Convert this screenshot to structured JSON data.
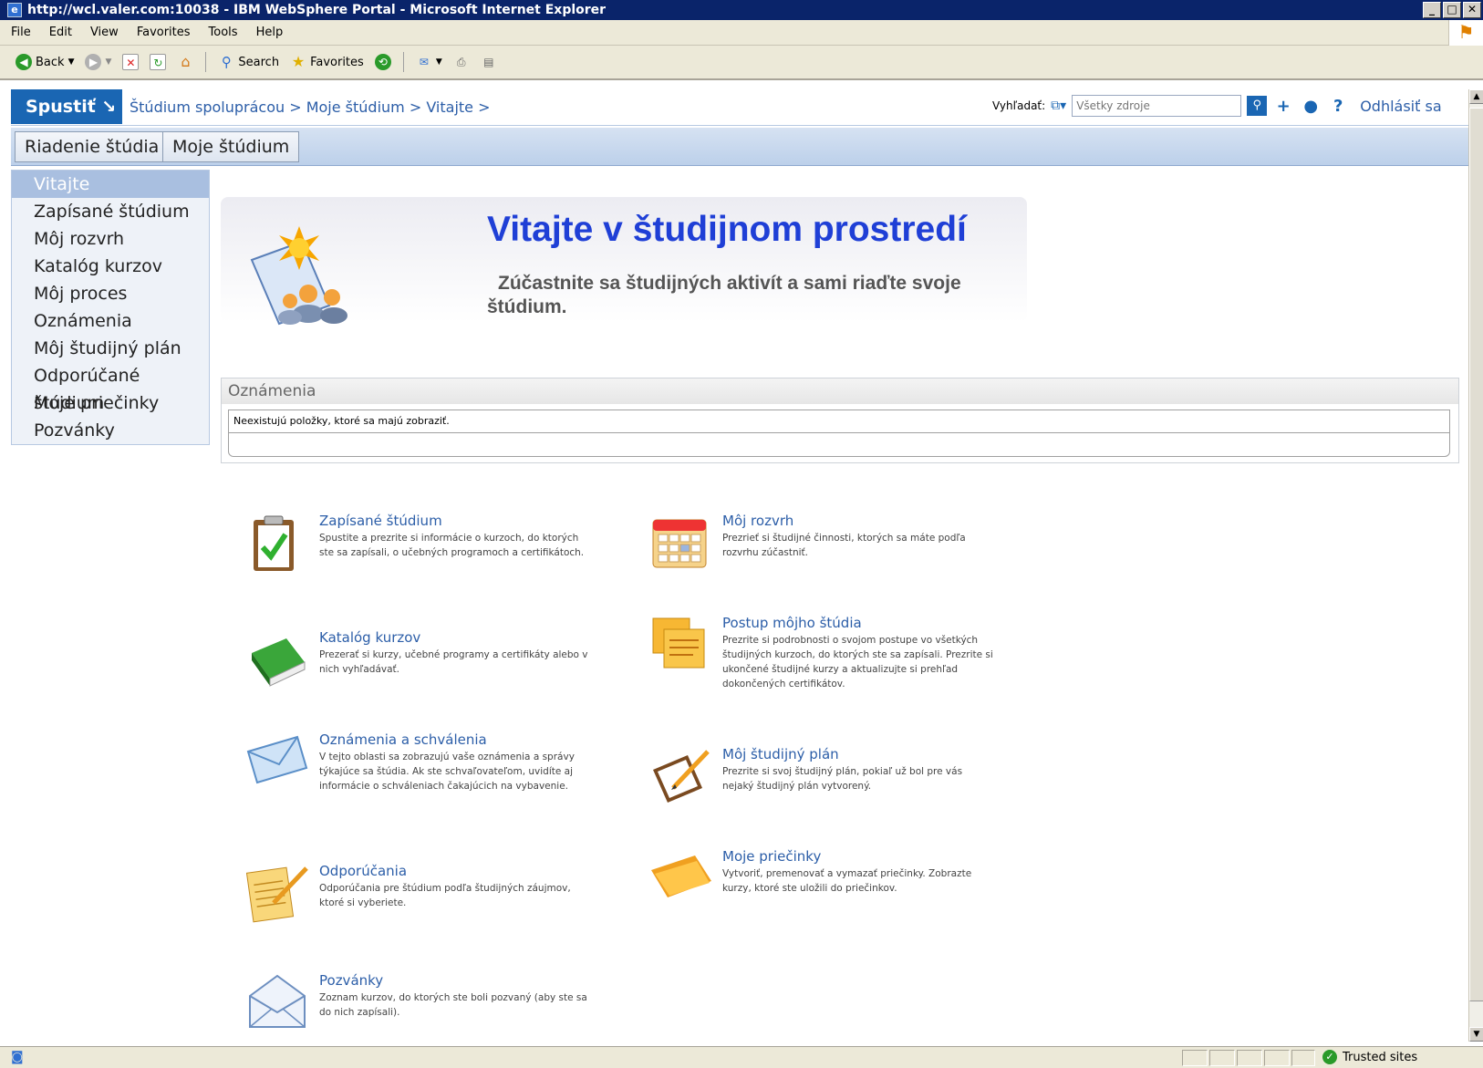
{
  "window": {
    "title": "http://wcl.valer.com:10038 - IBM WebSphere Portal - Microsoft Internet Explorer"
  },
  "menubar": {
    "items": [
      "File",
      "Edit",
      "View",
      "Favorites",
      "Tools",
      "Help"
    ]
  },
  "toolbar": {
    "back": "Back",
    "search": "Search",
    "favorites": "Favorites"
  },
  "header": {
    "launch": "Spustiť ↘",
    "breadcrumb": "Štúdium spoluprácou > Moje štúdium > Vitajte >",
    "search_label": "Vyhľadať:",
    "search_placeholder": "Všetky zdroje",
    "logout": "Odhlásiť sa"
  },
  "tabs": [
    "Riadenie štúdia",
    "Moje štúdium"
  ],
  "nav": {
    "items": [
      "Vitajte",
      "Zapísané štúdium",
      "Môj rozvrh",
      "Katalóg kurzov",
      "Môj proces",
      "Oznámenia",
      "Môj študijný plán",
      "Odporúčané štúdium",
      "Moje priečinky",
      "Pozvánky"
    ],
    "active_index": 0
  },
  "welcome": {
    "title": "Vitajte v študijnom prostredí",
    "subtitle": "Zúčastnite sa študijných aktivít a sami riaďte svoje štúdium."
  },
  "announcements": {
    "title": "Oznámenia",
    "empty_text": "Neexistujú položky, ktoré sa majú zobraziť."
  },
  "features": [
    {
      "icon": "clipboard-check-icon",
      "title": "Zapísané štúdium",
      "desc": "Spustite a prezrite si informácie o kurzoch, do ktorých ste sa zapísali, o učebných programoch a certifikátoch."
    },
    {
      "icon": "calendar-icon",
      "title": "Môj rozvrh",
      "desc": "Prezrieť si študijné činnosti, ktorých sa máte podľa rozvrhu zúčastniť."
    },
    {
      "icon": "book-icon",
      "title": "Katalóg kurzov",
      "desc": "Prezerať si kurzy, učebné programy a certifikáty alebo v nich vyhľadávať."
    },
    {
      "icon": "notes-icon",
      "title": "Postup môjho štúdia",
      "desc": "Prezrite si podrobnosti o svojom postupe vo všetkých študijných kurzoch, do ktorých ste sa zapísali. Prezrite si ukončené študijné kurzy a aktualizujte si prehľad dokončených certifikátov."
    },
    {
      "icon": "envelope-icon",
      "title": "Oznámenia a schválenia",
      "desc": "V tejto oblasti sa zobrazujú vaše oznámenia a správy týkajúce sa štúdia. Ak ste schvaľovateľom, uvidíte aj informácie o schváleniach čakajúcich na vybavenie."
    },
    {
      "icon": "clipboard-pencil-icon",
      "title": "Môj študijný plán",
      "desc": "Prezrite si svoj študijný plán, pokiaľ už bol pre vás nejaký študijný plán vytvorený."
    },
    {
      "icon": "notepad-pencil-icon",
      "title": "Odporúčania",
      "desc": "Odporúčania pre štúdium podľa študijných záujmov, ktoré si vyberiete."
    },
    {
      "icon": "folder-icon",
      "title": "Moje priečinky",
      "desc": "Vytvoriť, premenovať a vymazať priečinky. Zobrazte kurzy, ktoré ste uložili do priečinkov."
    },
    {
      "icon": "open-envelope-icon",
      "title": "Pozvánky",
      "desc": "Zoznam kurzov, do ktorých ste boli pozvaný (aby ste sa do nich zapísali)."
    }
  ],
  "status": {
    "zone": "Trusted sites"
  },
  "colors": {
    "accent": "#1a66b3",
    "link": "#2c5ea8",
    "title_blue": "#1f3fd6",
    "ie_titlebar": "#0a246a"
  }
}
